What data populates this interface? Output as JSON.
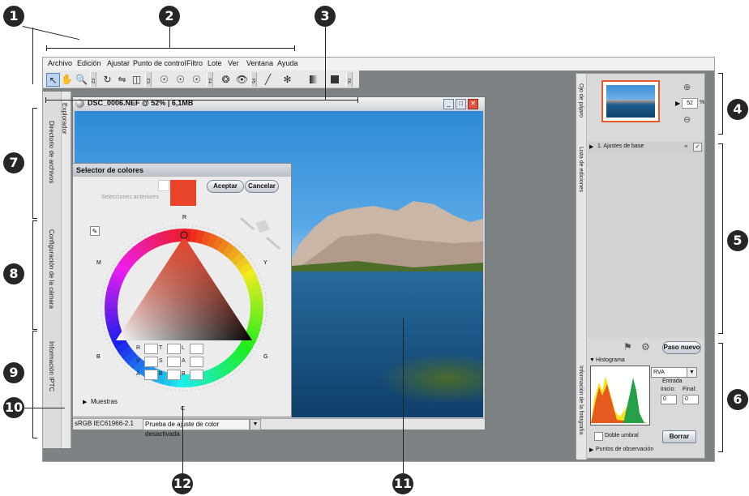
{
  "callouts": [
    "1",
    "2",
    "3",
    "4",
    "5",
    "6",
    "7",
    "8",
    "9",
    "10",
    "11",
    "12"
  ],
  "menu": [
    "Archivo",
    "Edición",
    "Ajustar",
    "Punto de control",
    "Filtro",
    "Lote",
    "Ver",
    "Ventana",
    "Ayuda"
  ],
  "toolbar_groups": [
    "F2",
    "F3",
    "F4",
    "F5",
    "F6"
  ],
  "left_tabs": [
    "Explorador",
    "Directorio de archivos",
    "Configuración de la cámara",
    "Información IPTC"
  ],
  "image_window": {
    "title": "DSC_0006.NEF @ 52% | 6,1MB"
  },
  "status": {
    "profile": "sRGB IEC61966-2.1",
    "softproof": "Prueba de ajuste de color desactivada"
  },
  "picker": {
    "title": "Selector de colores",
    "ok": "Aceptar",
    "cancel": "Cancelar",
    "previous": "Selecciones anteriores",
    "swatches": "Muestras",
    "wheel_labels": {
      "r": "R",
      "y": "Y",
      "g": "G",
      "c": "C",
      "b": "B",
      "m": "M"
    },
    "fields": [
      [
        "R",
        "T",
        "L"
      ],
      [
        "V",
        "S",
        "A"
      ],
      [
        "A",
        "B",
        "B"
      ]
    ],
    "color": "#e8442a"
  },
  "right_panel": {
    "birdseye": "Ojo de pájaro",
    "zoom_value": "52",
    "zoom_unit": "%",
    "edit_list": "Lista de ediciones",
    "base_adjust": "1. Ajustes de base",
    "new_step": "Paso nuevo",
    "info": "Información de la fotografía",
    "histogram": "Histograma",
    "channel": "RVA",
    "entrada": "Entrada",
    "inicio": "Inicio:",
    "final": "Final:",
    "inicio_val": "0",
    "final_val": "0",
    "threshold": "Doble umbral",
    "clear": "Borrar",
    "watch_points": "Puntos de observación"
  },
  "colors": {
    "accent_red": "#e8442a",
    "window_bg": "#7d8385",
    "sky": "#58a8e6"
  }
}
